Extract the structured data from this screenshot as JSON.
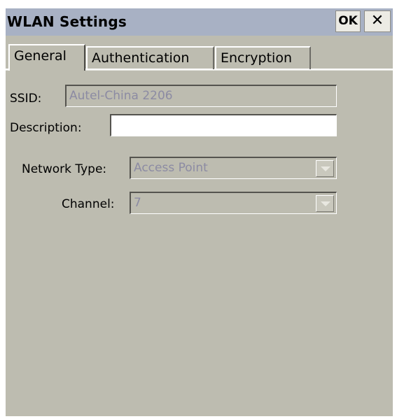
{
  "window": {
    "title": "WLAN Settings",
    "ok_label": "OK",
    "close_icon": "close-icon",
    "close_glyph": "✕"
  },
  "tabs": [
    {
      "label": "General",
      "active": true
    },
    {
      "label": "Authentication",
      "active": false
    },
    {
      "label": "Encryption",
      "active": false
    }
  ],
  "form": {
    "ssid": {
      "label": "SSID:",
      "value": "Autel-China 2206",
      "enabled": false
    },
    "description": {
      "label": "Description:",
      "value": "",
      "enabled": true
    },
    "network_type": {
      "label": "Network Type:",
      "value": "Access Point",
      "enabled": false
    },
    "channel": {
      "label": "Channel:",
      "value": "7",
      "enabled": false
    }
  },
  "colors": {
    "dialog_bg": "#bdbcb0",
    "titlebar_bg": "#a8b1c4",
    "disabled_text": "#8c8ba3"
  }
}
